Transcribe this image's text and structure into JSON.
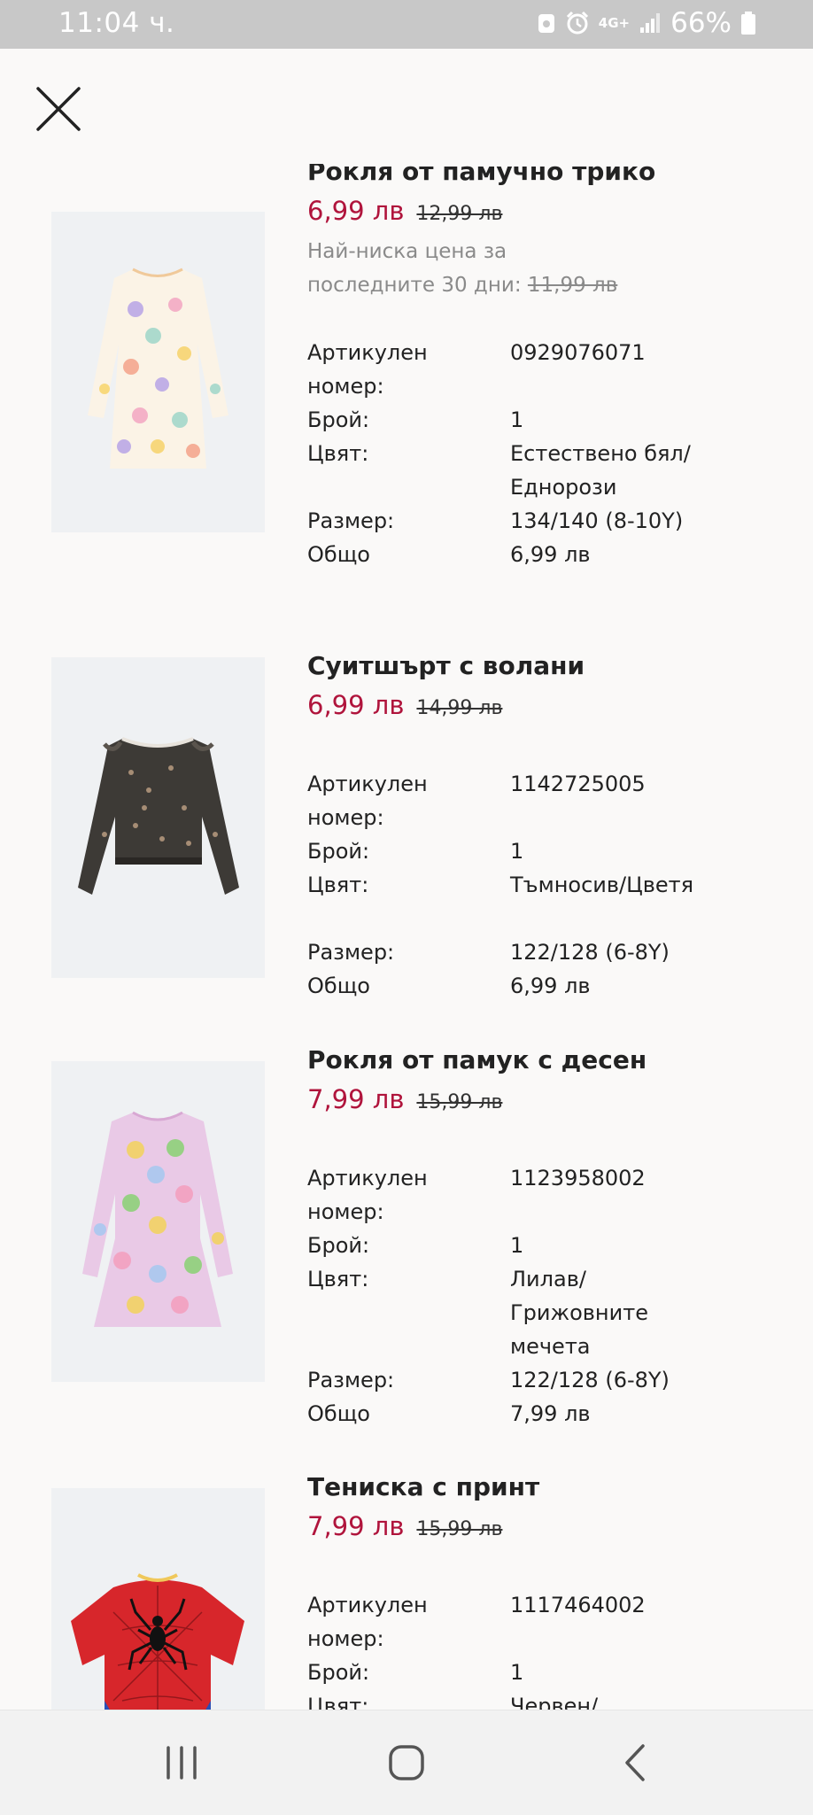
{
  "status_bar": {
    "time": "11:04 ч.",
    "network": "4G+",
    "battery": "66%"
  },
  "products": [
    {
      "name": "Рокля от памучно трико",
      "price_now": "6,99 лв",
      "price_old": "12,99 лв",
      "lowest_label": "Най-ниска цена за последните 30 дни:",
      "lowest_value": "11,99 лв",
      "details": [
        {
          "label": "Артикулен номер:",
          "value": "0929076071"
        },
        {
          "label": "Брой:",
          "value": "1"
        },
        {
          "label": "Цвят:",
          "value": "Естествено бял/ Еднорози"
        },
        {
          "label": "Размер:",
          "value": "134/140 (8-10Y)"
        },
        {
          "label": "Общо",
          "value": "6,99 лв"
        }
      ]
    },
    {
      "name": "Суитшърт с волани",
      "price_now": "6,99 лв",
      "price_old": "14,99 лв",
      "details": [
        {
          "label": "Артикулен номер:",
          "value": "1142725005"
        },
        {
          "label": "Брой:",
          "value": "1"
        },
        {
          "label": "Цвят:",
          "value": "Тъмносив/Цветя"
        },
        {
          "label": "Размер:",
          "value": "122/128 (6-8Y)"
        },
        {
          "label": "Общо",
          "value": "6,99 лв"
        }
      ]
    },
    {
      "name": "Рокля от памук с десен",
      "price_now": "7,99 лв",
      "price_old": "15,99 лв",
      "details": [
        {
          "label": "Артикулен номер:",
          "value": "1123958002"
        },
        {
          "label": "Брой:",
          "value": "1"
        },
        {
          "label": "Цвят:",
          "value": "Лилав/ Грижовните мечета"
        },
        {
          "label": "Размер:",
          "value": "122/128 (6-8Y)"
        },
        {
          "label": "Общо",
          "value": "7,99 лв"
        }
      ]
    },
    {
      "name": "Тениска с принт",
      "price_now": "7,99 лв",
      "price_old": "15,99 лв",
      "details": [
        {
          "label": "Артикулен номер:",
          "value": "1117464002"
        },
        {
          "label": "Брой:",
          "value": "1"
        },
        {
          "label": "Цвят:",
          "value": "Червен/"
        }
      ]
    }
  ],
  "colors": {
    "sale_price": "#b0143c",
    "status_bar_bg": "#c8c8c8",
    "page_bg": "#faf9f8",
    "nav_bar_bg": "#f2f2f2"
  },
  "icons": {
    "close": "close-icon",
    "nav_recents": "recent-apps-icon",
    "nav_home": "home-icon",
    "nav_back": "back-icon"
  }
}
